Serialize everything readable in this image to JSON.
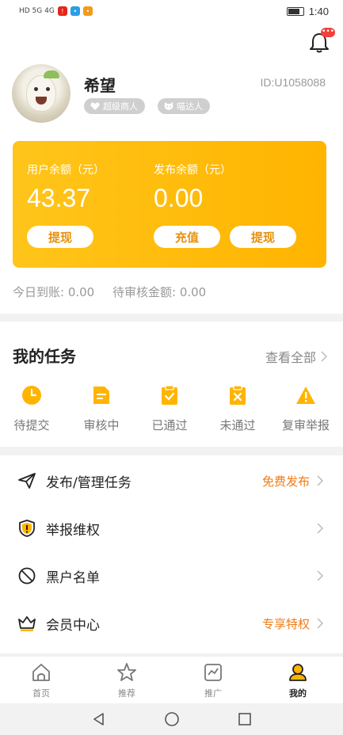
{
  "status_bar": {
    "left_text": "HD 5G 4G",
    "time": "1:40"
  },
  "header": {
    "notification_badge": "•••"
  },
  "profile": {
    "username": "希望",
    "user_id": "ID:U1058088",
    "tags": [
      {
        "label": "超级商人",
        "icon": "heart-icon"
      },
      {
        "label": "喵达人",
        "icon": "cat-icon"
      }
    ]
  },
  "wallet": {
    "user_balance_label": "用户余额（元）",
    "user_balance": "43.37",
    "publish_balance_label": "发布余额（元）",
    "publish_balance": "0.00",
    "withdraw_label": "提现",
    "recharge_label": "充值",
    "withdraw2_label": "提现",
    "gradient_start": "#ffc51a",
    "gradient_end": "#ffb400"
  },
  "summary": {
    "today_received": "今日到账: 0.00",
    "pending_review": "待审核金额: 0.00"
  },
  "tasks": {
    "title": "我的任务",
    "see_all": "查看全部",
    "items": [
      {
        "label": "待提交",
        "icon": "clock-icon"
      },
      {
        "label": "审核中",
        "icon": "document-icon"
      },
      {
        "label": "已通过",
        "icon": "clipboard-check-icon"
      },
      {
        "label": "未通过",
        "icon": "clipboard-x-icon"
      },
      {
        "label": "复审举报",
        "icon": "warning-icon"
      }
    ],
    "icon_color": "#ffb400"
  },
  "menu": {
    "items": [
      {
        "label": "发布/管理任务",
        "extra": "免费发布",
        "icon": "send-icon"
      },
      {
        "label": "举报维权",
        "extra": "",
        "icon": "shield-alert-icon"
      },
      {
        "label": "黑户名单",
        "extra": "",
        "icon": "ban-icon"
      },
      {
        "label": "会员中心",
        "extra": "专享特权",
        "icon": "crown-icon"
      }
    ],
    "extra_color": "#f07b14"
  },
  "tabbar": {
    "items": [
      {
        "label": "首页",
        "icon": "home-icon",
        "active": false
      },
      {
        "label": "推荐",
        "icon": "star-icon",
        "active": false
      },
      {
        "label": "推广",
        "icon": "chart-icon",
        "active": false
      },
      {
        "label": "我的",
        "icon": "profile-icon",
        "active": true
      }
    ]
  }
}
